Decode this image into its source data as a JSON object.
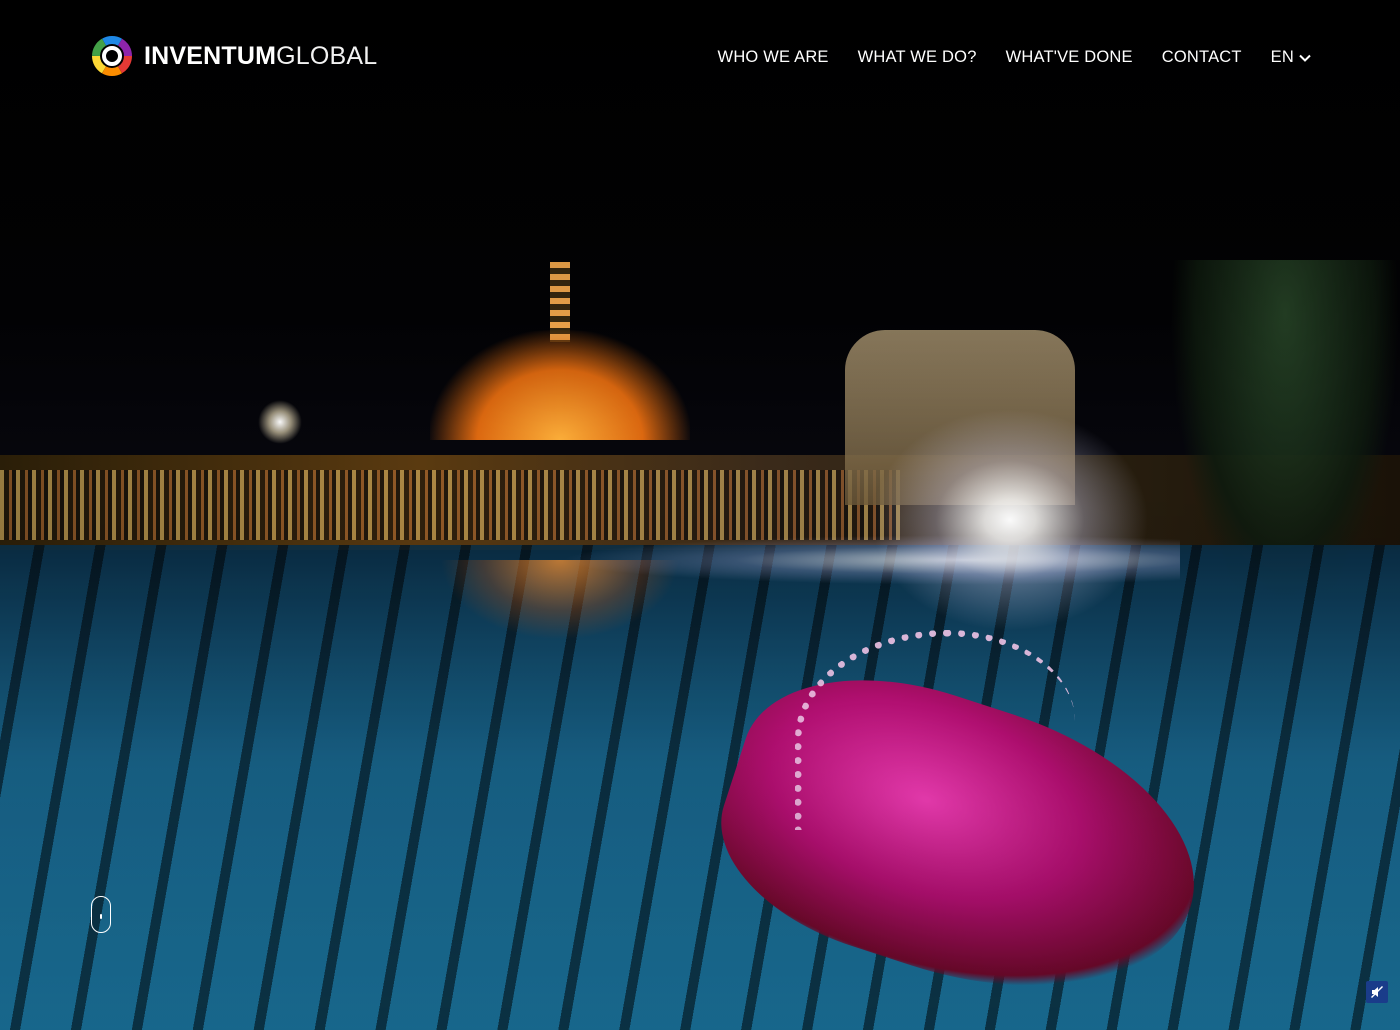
{
  "brand": {
    "name_bold": "INVENTUM",
    "name_light": "GLOBAL",
    "logo_icon": "ring-logo-icon",
    "logo_colors": [
      "#e53935",
      "#fb8c00",
      "#fdd835",
      "#43a047",
      "#1e88e5",
      "#8e24aa"
    ]
  },
  "nav": {
    "items": [
      {
        "label": "WHO WE ARE"
      },
      {
        "label": "WHAT WE DO?"
      },
      {
        "label": "WHAT'VE DONE"
      },
      {
        "label": "CONTACT"
      }
    ],
    "language": {
      "label": "EN",
      "icon": "chevron-down-icon"
    }
  },
  "hero": {
    "media": "background-video",
    "scroll_icon": "scroll-mouse-icon",
    "mute_icon": "speaker-muted-icon",
    "mute_color": "#1a3c8a"
  }
}
